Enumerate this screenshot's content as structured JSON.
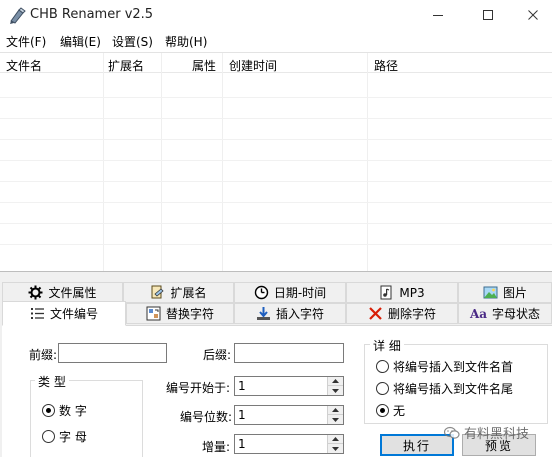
{
  "window": {
    "title": "CHB Renamer v2.5",
    "controls": {
      "minimize_icon": "minimize-icon",
      "maximize_icon": "maximize-icon",
      "close_icon": "close-icon"
    }
  },
  "menu": [
    {
      "label": "文件(F)"
    },
    {
      "label": "编辑(E)"
    },
    {
      "label": "设置(S)"
    },
    {
      "label": "帮助(H)"
    }
  ],
  "file_list": {
    "columns": [
      "文件名",
      "扩展名",
      "属性",
      "创建时间",
      "路径"
    ],
    "rows": []
  },
  "tabs_row1": [
    {
      "label": "文件属性",
      "icon": "attributes-icon"
    },
    {
      "label": "扩展名",
      "icon": "extension-icon"
    },
    {
      "label": "日期-时间",
      "icon": "clock-icon"
    },
    {
      "label": "MP3",
      "icon": "mp3-icon"
    },
    {
      "label": "图片",
      "icon": "image-icon"
    }
  ],
  "tabs_row2": [
    {
      "label": "文件编号",
      "icon": "numbering-icon",
      "active": true
    },
    {
      "label": "替换字符",
      "icon": "replace-icon"
    },
    {
      "label": "插入字符",
      "icon": "insert-icon"
    },
    {
      "label": "删除字符",
      "icon": "delete-icon"
    },
    {
      "label": "字母状态",
      "icon": "letter-case-icon",
      "icon_text": "Aa"
    }
  ],
  "numbering": {
    "prefix_label": "前缀:",
    "prefix_value": "",
    "suffix_label": "后缀:",
    "suffix_value": "",
    "type_group": {
      "title": "类 型",
      "options": [
        {
          "label": "数 字",
          "checked": true
        },
        {
          "label": "字 母",
          "checked": false
        }
      ]
    },
    "start_label": "编号开始于:",
    "start_value": "1",
    "digits_label": "编号位数:",
    "digits_value": "1",
    "increment_label": "增量:",
    "increment_value": "1",
    "detail_group": {
      "title": "详 细",
      "options": [
        {
          "label": "将编号插入到文件名首",
          "checked": false
        },
        {
          "label": "将编号插入到文件名尾",
          "checked": false
        },
        {
          "label": "无",
          "checked": true
        }
      ]
    },
    "execute_label": "执行",
    "preview_label": "预览"
  },
  "watermark": {
    "text": "有料黑科技",
    "icon": "wechat-icon"
  },
  "colors": {
    "tab_background": "#f0f0f0",
    "panel_background": "#ffffff",
    "focus_accent": "#0078d7",
    "delete_red": "#d81e06"
  }
}
